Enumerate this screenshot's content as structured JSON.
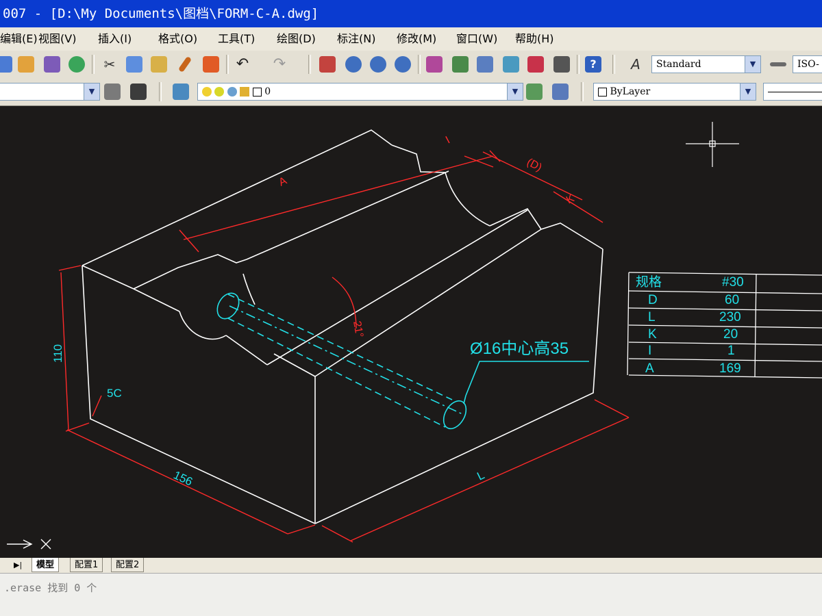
{
  "window": {
    "title": "007 - [D:\\My Documents\\图档\\FORM-C-A.dwg]"
  },
  "menu": {
    "items": [
      "编辑(E)",
      "视图(V)",
      "插入(I)",
      "格式(O)",
      "工具(T)",
      "绘图(D)",
      "标注(N)",
      "修改(M)",
      "窗口(W)",
      "帮助(H)"
    ]
  },
  "toolbar": {
    "text_style": "Standard",
    "dim_style": "ISO-",
    "layer": "0",
    "color": "ByLayer"
  },
  "colors": {
    "drawing_bg": "#1c1a19",
    "lines": "#ffffff",
    "dims": "#ff2a2a",
    "text": "#22e0e8"
  },
  "drawing": {
    "dim_labels": {
      "A": "A",
      "I": "I",
      "D": "(D)",
      "K": "K",
      "height": "110",
      "chamfer": "5C",
      "width": "156",
      "L": "L",
      "angle": "21°"
    },
    "note": "Ø16中心高35"
  },
  "spec_table": {
    "header": [
      "规格",
      "#30"
    ],
    "rows": [
      [
        "D",
        "60"
      ],
      [
        "L",
        "230"
      ],
      [
        "K",
        "20"
      ],
      [
        "I",
        "1"
      ],
      [
        "A",
        "169"
      ]
    ]
  },
  "tabs": [
    "模型",
    "配置1",
    "配置2"
  ],
  "command_line": {
    "text": ".erase 找到 0 个"
  }
}
